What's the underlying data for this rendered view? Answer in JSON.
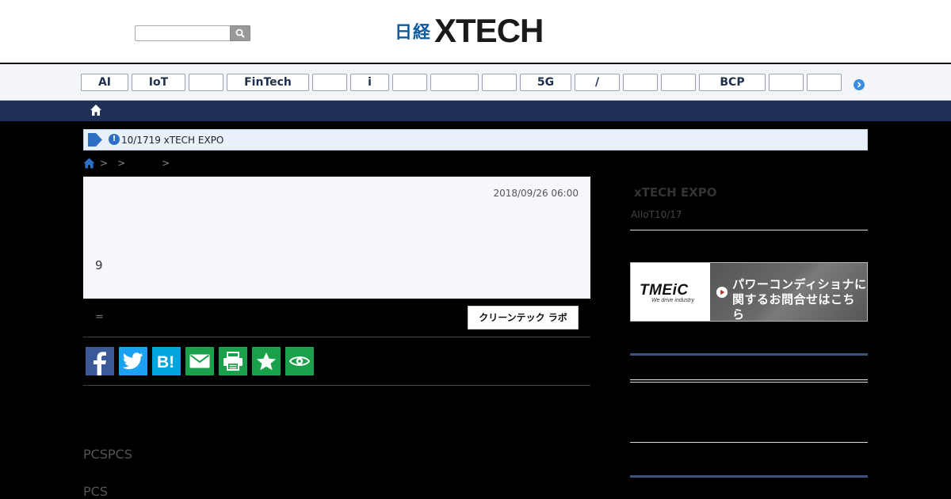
{
  "header": {
    "search_placeholder": "",
    "logo_prefix": "日経",
    "logo_main": "XTECH"
  },
  "categories": [
    {
      "label": "AI"
    },
    {
      "label": "IoT"
    },
    {
      "label": ""
    },
    {
      "label": "FinTech"
    },
    {
      "label": ""
    },
    {
      "label": "i"
    },
    {
      "label": ""
    },
    {
      "label": ""
    },
    {
      "label": ""
    },
    {
      "label": "5G"
    },
    {
      "label": "/"
    },
    {
      "label": ""
    },
    {
      "label": ""
    },
    {
      "label": "BCP"
    },
    {
      "label": ""
    },
    {
      "label": ""
    }
  ],
  "notice": {
    "text": "10/1719 xTECH EXPO"
  },
  "breadcrumb": {
    "sep": ">"
  },
  "article": {
    "date": "2018/09/26 06:00",
    "lead": "9",
    "author": "=",
    "clean_button": "クリーンテック ラボ"
  },
  "share": [
    {
      "icon": "facebook-icon",
      "color": "#3b5998"
    },
    {
      "icon": "twitter-icon",
      "color": "#1da1f2"
    },
    {
      "icon": "hatena-icon",
      "color": "#00a4de"
    },
    {
      "icon": "mail-icon",
      "color": "#1aa04a"
    },
    {
      "icon": "print-icon",
      "color": "#1aa04a"
    },
    {
      "icon": "star-icon",
      "color": "#1aa04a"
    },
    {
      "icon": "eye-icon",
      "color": "#1aa04a"
    }
  ],
  "body": {
    "p1": "PCSPCS",
    "p2": "PCS"
  },
  "sidebar": {
    "title": "xTECH EXPO",
    "sub": "AIIoT10/17",
    "ad_logo": "TMEiC",
    "ad_tagline": "We drive industry",
    "ad_line1": "パワーコンディショナに",
    "ad_line2": "関するお問合せはこちら"
  }
}
